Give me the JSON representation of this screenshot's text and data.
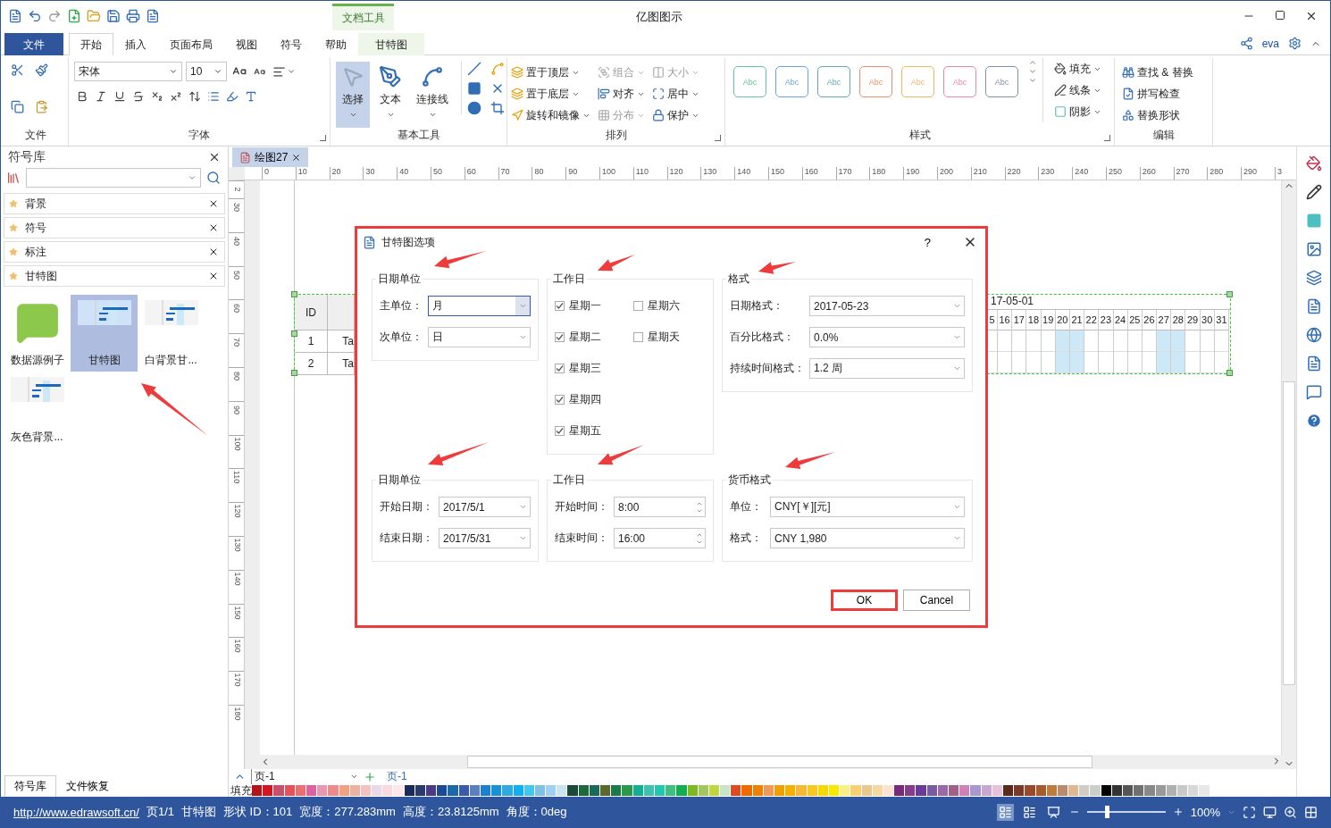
{
  "window": {
    "title": "亿图图示",
    "context_group": "文档工具"
  },
  "menu_tabs": [
    {
      "label": "文件",
      "kind": "file",
      "selected": false
    },
    {
      "label": "开始",
      "kind": "tab",
      "selected": true
    },
    {
      "label": "插入",
      "kind": "tab",
      "selected": false
    },
    {
      "label": "页面布局",
      "kind": "tab",
      "selected": false
    },
    {
      "label": "视图",
      "kind": "tab",
      "selected": false
    },
    {
      "label": "符号",
      "kind": "tab",
      "selected": false
    },
    {
      "label": "帮助",
      "kind": "tab",
      "selected": false
    },
    {
      "label": "甘特图",
      "kind": "context",
      "selected": false
    }
  ],
  "user": "eva",
  "ribbon": {
    "file_group": {
      "title": "文件"
    },
    "font_group": {
      "title": "字体",
      "font": "宋体",
      "size": "10"
    },
    "tools_group": {
      "title": "基本工具",
      "tools": [
        {
          "label": "选择",
          "selected": true
        },
        {
          "label": "文本",
          "selected": false
        },
        {
          "label": "连接线",
          "selected": false
        }
      ]
    },
    "arrange_group": {
      "title": "排列",
      "items": [
        {
          "label": "置于顶层",
          "disabled": false
        },
        {
          "label": "置于底层",
          "disabled": false
        },
        {
          "label": "旋转和镜像",
          "disabled": false
        },
        {
          "label": "组合",
          "disabled": true
        },
        {
          "label": "对齐",
          "disabled": false
        },
        {
          "label": "分布",
          "disabled": true
        },
        {
          "label": "大小",
          "disabled": true
        },
        {
          "label": "居中",
          "disabled": false
        },
        {
          "label": "保护",
          "disabled": false
        }
      ]
    },
    "styles_group": {
      "title": "样式",
      "swatches": [
        {
          "label": "Abc",
          "color": "#63c59a"
        },
        {
          "label": "Abc",
          "color": "#6aa2e0"
        },
        {
          "label": "Abc",
          "color": "#5eaab8"
        },
        {
          "label": "Abc",
          "color": "#f0906a"
        },
        {
          "label": "Abc",
          "color": "#f2b460"
        },
        {
          "label": "Abc",
          "color": "#e88aa2"
        },
        {
          "label": "Abc",
          "color": "#8090a8"
        }
      ],
      "props": [
        "填充",
        "线条",
        "阴影"
      ]
    },
    "edit_group": {
      "title": "编辑",
      "items": [
        "查找 & 替换",
        "拼写检查",
        "替换形状"
      ]
    }
  },
  "library": {
    "title": "符号库",
    "categories": [
      "背景",
      "符号",
      "标注",
      "甘特图"
    ],
    "shapes": [
      {
        "label": "数据源例子",
        "kind": "question",
        "selected": false
      },
      {
        "label": "甘特图",
        "kind": "gantt",
        "selected": true
      },
      {
        "label": "白背景甘...",
        "kind": "gantt",
        "selected": false
      },
      {
        "label": "灰色背景...",
        "kind": "gantt",
        "selected": false
      }
    ]
  },
  "document_tab": "绘图27",
  "ruler": {
    "h": [
      "0",
      "10",
      "20",
      "30",
      "40",
      "50",
      "60",
      "70",
      "80",
      "90",
      "100",
      "110",
      "120",
      "130",
      "140",
      "150",
      "160",
      "170",
      "180",
      "190",
      "200",
      "210",
      "220",
      "230",
      "240",
      "250",
      "260",
      "270",
      "280",
      "290",
      "3"
    ],
    "v": [
      "2",
      "30",
      "40",
      "50",
      "60",
      "70",
      "80",
      "90",
      "100",
      "110",
      "120",
      "130",
      "140",
      "150",
      "160",
      "170",
      "180"
    ]
  },
  "gantt": {
    "id_header": "ID",
    "rows": [
      {
        "id": "1",
        "name": "Ta"
      },
      {
        "id": "2",
        "name": "Ta"
      }
    ],
    "period": "17-05-01",
    "days": [
      {
        "day": "5",
        "weekend": false
      },
      {
        "day": "16",
        "weekend": false
      },
      {
        "day": "17",
        "weekend": false
      },
      {
        "day": "18",
        "weekend": false
      },
      {
        "day": "19",
        "weekend": false
      },
      {
        "day": "20",
        "weekend": true
      },
      {
        "day": "21",
        "weekend": true
      },
      {
        "day": "22",
        "weekend": false
      },
      {
        "day": "23",
        "weekend": false
      },
      {
        "day": "24",
        "weekend": false
      },
      {
        "day": "25",
        "weekend": false
      },
      {
        "day": "26",
        "weekend": false
      },
      {
        "day": "27",
        "weekend": true
      },
      {
        "day": "28",
        "weekend": true
      },
      {
        "day": "29",
        "weekend": false
      },
      {
        "day": "30",
        "weekend": false
      },
      {
        "day": "31",
        "weekend": false
      }
    ]
  },
  "dialog": {
    "title": "甘特图选项",
    "help": "?",
    "groups": [
      {
        "kind": "fields",
        "title": "日期单位",
        "fields": [
          {
            "label": "主单位：",
            "value": "月",
            "kind": "dropdown",
            "focused": true
          },
          {
            "label": "次单位：",
            "value": "日",
            "kind": "dropdown",
            "focused": false
          }
        ]
      },
      {
        "kind": "checks",
        "title": "工作日",
        "columns": [
          [
            {
              "label": "星期一",
              "checked": true
            },
            {
              "label": "星期二",
              "checked": true
            },
            {
              "label": "星期三",
              "checked": true
            },
            {
              "label": "星期四",
              "checked": true
            },
            {
              "label": "星期五",
              "checked": true
            }
          ],
          [
            {
              "label": "星期六",
              "checked": false
            },
            {
              "label": "星期天",
              "checked": false
            }
          ]
        ]
      },
      {
        "kind": "fields",
        "title": "格式",
        "fields": [
          {
            "label": "日期格式：",
            "value": "2017-05-23",
            "kind": "dropdown",
            "focused": false
          },
          {
            "label": "百分比格式：",
            "value": "0.0%",
            "kind": "dropdown",
            "focused": false
          },
          {
            "label": "持续时间格式：",
            "value": "1.2 周",
            "kind": "dropdown",
            "focused": false
          }
        ]
      },
      {
        "kind": "fields",
        "title": "日期单位",
        "fields": [
          {
            "label": "开始日期：",
            "value": "2017/5/1",
            "kind": "dropdown",
            "focused": false
          },
          {
            "label": "结束日期：",
            "value": "2017/5/31",
            "kind": "dropdown",
            "focused": false
          }
        ]
      },
      {
        "kind": "fields",
        "title": "工作日",
        "fields": [
          {
            "label": "开始时间：",
            "value": "8:00",
            "kind": "spin",
            "focused": false
          },
          {
            "label": "结束时间：",
            "value": "16:00",
            "kind": "spin",
            "focused": false
          }
        ]
      },
      {
        "kind": "fields",
        "title": "货币格式",
        "fields": [
          {
            "label": "单位：",
            "value": "CNY[￥][元]",
            "kind": "dropdown",
            "focused": false
          },
          {
            "label": "格式：",
            "value": "CNY 1,980",
            "kind": "dropdown",
            "focused": false
          }
        ]
      }
    ],
    "buttons": [
      {
        "label": "OK",
        "highlighted": true
      },
      {
        "label": "Cancel",
        "highlighted": false
      }
    ]
  },
  "page_bar": {
    "page_select": "页-1",
    "page_tab": "页-1",
    "fill_label": "填充"
  },
  "palette": [
    {
      "color": "#b5121b"
    },
    {
      "color": "#d7141f"
    },
    {
      "color": "#c8506c"
    },
    {
      "color": "#e8505a"
    },
    {
      "color": "#e87070"
    },
    {
      "color": "#e060a0"
    },
    {
      "color": "#e898b0"
    },
    {
      "color": "#f08a8a"
    },
    {
      "color": "#f4a080"
    },
    {
      "color": "#f0b0a0"
    },
    {
      "color": "#f4c0c0"
    },
    {
      "color": "#e8d8e8"
    },
    {
      "color": "#fcd8e0"
    },
    {
      "color": "#fce8e8"
    },
    {
      "color": "#1a2a5a"
    },
    {
      "color": "#2a3a6a"
    },
    {
      "color": "#4a3a8a"
    },
    {
      "color": "#1a4a9a"
    },
    {
      "color": "#1a6aaa"
    },
    {
      "color": "#3a5aaa"
    },
    {
      "color": "#5a80c0"
    },
    {
      "color": "#1a80d0"
    },
    {
      "color": "#1a90d8"
    },
    {
      "color": "#30a8e0"
    },
    {
      "color": "#10b0f0"
    },
    {
      "color": "#40c8f0"
    },
    {
      "color": "#80c0e8"
    },
    {
      "color": "#a0d0f0"
    },
    {
      "color": "#c8e4f0"
    },
    {
      "color": "#1a4a3a"
    },
    {
      "color": "#1a6a3a"
    },
    {
      "color": "#1a6a5a"
    },
    {
      "color": "#5a6a2a"
    },
    {
      "color": "#1a7a4a"
    },
    {
      "color": "#2a9a4a"
    },
    {
      "color": "#10b090"
    },
    {
      "color": "#40c0b0"
    },
    {
      "color": "#20c8b0"
    },
    {
      "color": "#40c080"
    },
    {
      "color": "#10b050"
    },
    {
      "color": "#80b820"
    },
    {
      "color": "#a0c860"
    },
    {
      "color": "#c0d840"
    },
    {
      "color": "#c8e4c8"
    },
    {
      "color": "#e04a20"
    },
    {
      "color": "#f06a00"
    },
    {
      "color": "#f08000"
    },
    {
      "color": "#f09a5a"
    },
    {
      "color": "#f0a000"
    },
    {
      "color": "#f8b000"
    },
    {
      "color": "#f8b830"
    },
    {
      "color": "#f8c820"
    },
    {
      "color": "#f8d800"
    },
    {
      "color": "#f8e800"
    },
    {
      "color": "#f8f080"
    },
    {
      "color": "#f8d070"
    },
    {
      "color": "#e8c890"
    },
    {
      "color": "#f8d8a0"
    },
    {
      "color": "#f8e4d0"
    },
    {
      "color": "#7a2a7a"
    },
    {
      "color": "#8a3a8a"
    },
    {
      "color": "#6a3a9a"
    },
    {
      "color": "#7a5aa0"
    },
    {
      "color": "#9a6aa8"
    },
    {
      "color": "#a06088"
    },
    {
      "color": "#d080b8"
    },
    {
      "color": "#a898d0"
    },
    {
      "color": "#c8a8d0"
    },
    {
      "color": "#e8c0d8"
    },
    {
      "color": "#5a2a1a"
    },
    {
      "color": "#7a3a2a"
    },
    {
      "color": "#9a4a2a"
    },
    {
      "color": "#a85a2a"
    },
    {
      "color": "#c07a3a"
    },
    {
      "color": "#b88a70"
    },
    {
      "color": "#e0b890"
    },
    {
      "color": "#d0ccc4"
    },
    {
      "color": "#c8d0c8"
    },
    {
      "color": "#000000"
    },
    {
      "color": "#333333"
    },
    {
      "color": "#555555"
    },
    {
      "color": "#707070"
    },
    {
      "color": "#888888"
    },
    {
      "color": "#999999"
    },
    {
      "color": "#b0b0b0"
    },
    {
      "color": "#c8c8c8"
    },
    {
      "color": "#d8d8d8"
    },
    {
      "color": "#e8e8e8"
    }
  ],
  "bottom_tabs": [
    {
      "label": "符号库",
      "selected": true
    },
    {
      "label": "文件恢复",
      "selected": false
    }
  ],
  "status": {
    "link": "http://www.edrawsoft.cn/",
    "items": [
      "页1/1",
      "甘特图",
      "形状 ID：101",
      "宽度：277.283mm",
      "高度：23.8125mm",
      "角度：0deg"
    ],
    "zoom": "100%",
    "zoom_slider": {
      "level": 0.23
    }
  }
}
